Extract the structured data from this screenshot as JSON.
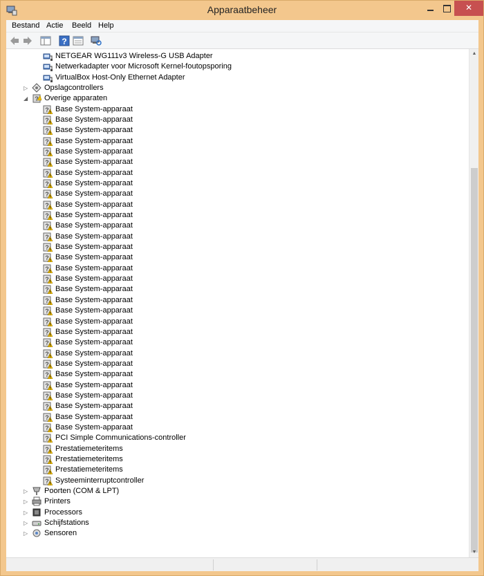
{
  "window": {
    "title": "Apparaatbeheer",
    "icon": "device-manager-icon"
  },
  "menu": [
    "Bestand",
    "Actie",
    "Beeld",
    "Help"
  ],
  "toolbar": [
    "back-arrow-icon",
    "forward-arrow-icon",
    "show-hide-console-tree-icon",
    "help-icon",
    "properties-icon",
    "scan-hardware-icon"
  ],
  "tree": [
    {
      "label": "NETGEAR WG111v3 Wireless-G USB Adapter",
      "level": 2,
      "icon": "network-adapter-icon"
    },
    {
      "label": "Netwerkadapter voor Microsoft Kernel-foutopsporing",
      "level": 2,
      "icon": "network-adapter-icon"
    },
    {
      "label": "VirtualBox Host-Only Ethernet Adapter",
      "level": 2,
      "icon": "network-adapter-icon"
    },
    {
      "label": "Opslagcontrollers",
      "level": 1,
      "icon": "storage-controller-icon",
      "expander": "collapsed"
    },
    {
      "label": "Overige apparaten",
      "level": 1,
      "icon": "other-devices-icon",
      "expander": "expanded"
    },
    {
      "label": "Base System-apparaat",
      "level": 2,
      "icon": "unknown-device-warning-icon"
    },
    {
      "label": "Base System-apparaat",
      "level": 2,
      "icon": "unknown-device-warning-icon"
    },
    {
      "label": "Base System-apparaat",
      "level": 2,
      "icon": "unknown-device-warning-icon"
    },
    {
      "label": "Base System-apparaat",
      "level": 2,
      "icon": "unknown-device-warning-icon"
    },
    {
      "label": "Base System-apparaat",
      "level": 2,
      "icon": "unknown-device-warning-icon"
    },
    {
      "label": "Base System-apparaat",
      "level": 2,
      "icon": "unknown-device-warning-icon"
    },
    {
      "label": "Base System-apparaat",
      "level": 2,
      "icon": "unknown-device-warning-icon"
    },
    {
      "label": "Base System-apparaat",
      "level": 2,
      "icon": "unknown-device-warning-icon"
    },
    {
      "label": "Base System-apparaat",
      "level": 2,
      "icon": "unknown-device-warning-icon"
    },
    {
      "label": "Base System-apparaat",
      "level": 2,
      "icon": "unknown-device-warning-icon"
    },
    {
      "label": "Base System-apparaat",
      "level": 2,
      "icon": "unknown-device-warning-icon"
    },
    {
      "label": "Base System-apparaat",
      "level": 2,
      "icon": "unknown-device-warning-icon"
    },
    {
      "label": "Base System-apparaat",
      "level": 2,
      "icon": "unknown-device-warning-icon"
    },
    {
      "label": "Base System-apparaat",
      "level": 2,
      "icon": "unknown-device-warning-icon"
    },
    {
      "label": "Base System-apparaat",
      "level": 2,
      "icon": "unknown-device-warning-icon"
    },
    {
      "label": "Base System-apparaat",
      "level": 2,
      "icon": "unknown-device-warning-icon"
    },
    {
      "label": "Base System-apparaat",
      "level": 2,
      "icon": "unknown-device-warning-icon"
    },
    {
      "label": "Base System-apparaat",
      "level": 2,
      "icon": "unknown-device-warning-icon"
    },
    {
      "label": "Base System-apparaat",
      "level": 2,
      "icon": "unknown-device-warning-icon"
    },
    {
      "label": "Base System-apparaat",
      "level": 2,
      "icon": "unknown-device-warning-icon"
    },
    {
      "label": "Base System-apparaat",
      "level": 2,
      "icon": "unknown-device-warning-icon"
    },
    {
      "label": "Base System-apparaat",
      "level": 2,
      "icon": "unknown-device-warning-icon"
    },
    {
      "label": "Base System-apparaat",
      "level": 2,
      "icon": "unknown-device-warning-icon"
    },
    {
      "label": "Base System-apparaat",
      "level": 2,
      "icon": "unknown-device-warning-icon"
    },
    {
      "label": "Base System-apparaat",
      "level": 2,
      "icon": "unknown-device-warning-icon"
    },
    {
      "label": "Base System-apparaat",
      "level": 2,
      "icon": "unknown-device-warning-icon"
    },
    {
      "label": "Base System-apparaat",
      "level": 2,
      "icon": "unknown-device-warning-icon"
    },
    {
      "label": "Base System-apparaat",
      "level": 2,
      "icon": "unknown-device-warning-icon"
    },
    {
      "label": "Base System-apparaat",
      "level": 2,
      "icon": "unknown-device-warning-icon"
    },
    {
      "label": "Base System-apparaat",
      "level": 2,
      "icon": "unknown-device-warning-icon"
    },
    {
      "label": "Base System-apparaat",
      "level": 2,
      "icon": "unknown-device-warning-icon"
    },
    {
      "label": "PCI Simple Communications-controller",
      "level": 2,
      "icon": "unknown-device-warning-icon"
    },
    {
      "label": "Prestatiemeteritems",
      "level": 2,
      "icon": "unknown-device-warning-icon"
    },
    {
      "label": "Prestatiemeteritems",
      "level": 2,
      "icon": "unknown-device-warning-icon"
    },
    {
      "label": "Prestatiemeteritems",
      "level": 2,
      "icon": "unknown-device-warning-icon"
    },
    {
      "label": "Systeeminterruptcontroller",
      "level": 2,
      "icon": "unknown-device-warning-icon"
    },
    {
      "label": "Poorten (COM & LPT)",
      "level": 1,
      "icon": "port-icon",
      "expander": "collapsed"
    },
    {
      "label": "Printers",
      "level": 1,
      "icon": "printer-icon",
      "expander": "collapsed"
    },
    {
      "label": "Processors",
      "level": 1,
      "icon": "processor-icon",
      "expander": "collapsed"
    },
    {
      "label": "Schijfstations",
      "level": 1,
      "icon": "disk-drive-icon",
      "expander": "collapsed"
    },
    {
      "label": "Sensoren",
      "level": 1,
      "icon": "sensor-icon",
      "expander": "collapsed"
    }
  ],
  "colors": {
    "frame": "#f3c78d",
    "close": "#c75050",
    "warning": "#f5c400"
  }
}
